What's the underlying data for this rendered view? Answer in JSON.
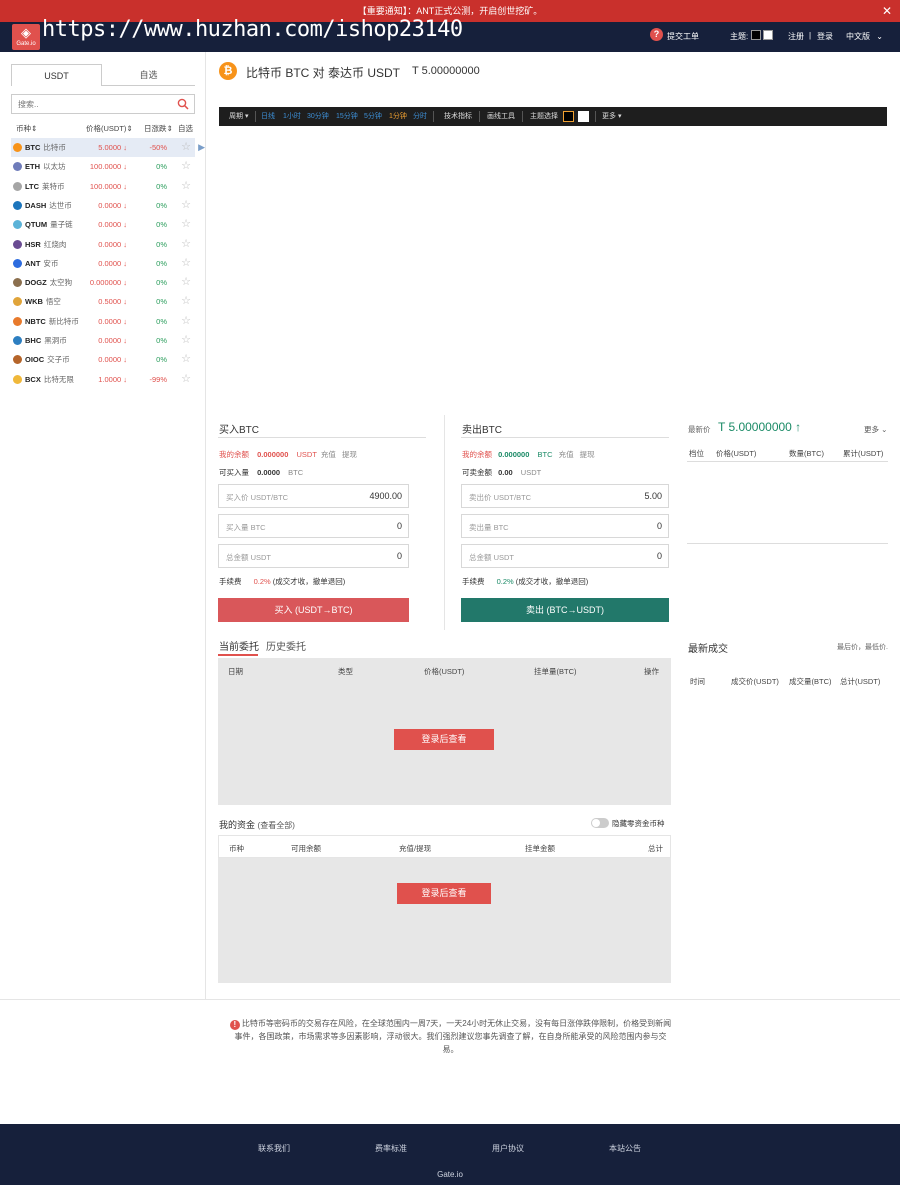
{
  "notice": {
    "text": "【重要通知】：ANT正式公测，开启创世挖矿。",
    "close": "✕"
  },
  "header": {
    "logo_text": "Gate.io",
    "watermark": "https://www.huzhan.com/ishop23140",
    "submit_ticket": "提交工单",
    "theme_label": "主题:",
    "register": "注册",
    "divider": "|",
    "login": "登录",
    "language": "中文版"
  },
  "market": {
    "tabs": [
      "USDT",
      "自选"
    ],
    "search_placeholder": "搜索..",
    "columns": [
      "币种⇕",
      "价格(USDT)⇕",
      "日涨跌⇕",
      "自选"
    ],
    "rows": [
      {
        "symbol": "BTC",
        "name": "比特币",
        "price": "5.0000 ↓",
        "change": "-50%",
        "neg": true,
        "color": "#f7931a"
      },
      {
        "symbol": "ETH",
        "name": "以太坊",
        "price": "100.0000 ↓",
        "change": "0%",
        "neg": false,
        "color": "#6f7cba"
      },
      {
        "symbol": "LTC",
        "name": "莱特币",
        "price": "100.0000 ↓",
        "change": "0%",
        "neg": false,
        "color": "#a5a5a5"
      },
      {
        "symbol": "DASH",
        "name": "达世币",
        "price": "0.0000 ↓",
        "change": "0%",
        "neg": false,
        "color": "#1c75bc"
      },
      {
        "symbol": "QTUM",
        "name": "量子链",
        "price": "0.0000 ↓",
        "change": "0%",
        "neg": false,
        "color": "#5cb3d8"
      },
      {
        "symbol": "HSR",
        "name": "红烧肉",
        "price": "0.0000 ↓",
        "change": "0%",
        "neg": false,
        "color": "#6a4c93"
      },
      {
        "symbol": "ANT",
        "name": "安币",
        "price": "0.0000 ↓",
        "change": "0%",
        "neg": false,
        "color": "#2d6cdf"
      },
      {
        "symbol": "DOGZ",
        "name": "太空狗",
        "price": "0.000000 ↓",
        "change": "0%",
        "neg": false,
        "color": "#8b6f4e"
      },
      {
        "symbol": "WKB",
        "name": "悟空",
        "price": "0.5000 ↓",
        "change": "0%",
        "neg": false,
        "color": "#e0a43a"
      },
      {
        "symbol": "NBTC",
        "name": "新比特币",
        "price": "0.0000 ↓",
        "change": "0%",
        "neg": false,
        "color": "#e87a2c"
      },
      {
        "symbol": "BHC",
        "name": "黑洞币",
        "price": "0.0000 ↓",
        "change": "0%",
        "neg": false,
        "color": "#2d7fc1"
      },
      {
        "symbol": "OIOC",
        "name": "交子币",
        "price": "0.0000 ↓",
        "change": "0%",
        "neg": false,
        "color": "#b5652a"
      },
      {
        "symbol": "BCX",
        "name": "比特无限",
        "price": "1.0000 ↓",
        "change": "-99%",
        "neg": true,
        "color": "#f0b83a"
      }
    ]
  },
  "pair": {
    "title": "比特币 BTC 对 泰达币 USDT",
    "price": "T 5.00000000"
  },
  "chart_toolbar": {
    "period": "周期 ▾",
    "intervals": [
      "日线",
      "1小时",
      "30分钟",
      "15分钟",
      "5分钟",
      "1分钟",
      "分时"
    ],
    "tech": "技术指标",
    "draw": "画线工具",
    "theme": "主题选择",
    "more": "更多 ▾"
  },
  "buy": {
    "title": "买入BTC",
    "balance_label": "我的余额",
    "balance": "0.000000",
    "unit": "USDT",
    "recharge": "充值",
    "withdraw": "提现",
    "avail_label": "可买入量",
    "avail": "0.0000",
    "avail_unit": "BTC",
    "price_ph": "买入价 USDT/BTC",
    "price_val": "4900.00",
    "amount_ph": "买入量 BTC",
    "amount_val": "0",
    "total_ph": "总金额 USDT",
    "total_val": "0",
    "fee_label": "手续费",
    "fee": "0.2%",
    "fee_note": "(成交才收，撤单退回)",
    "button": "买入 (USDT→BTC)"
  },
  "sell": {
    "title": "卖出BTC",
    "balance_label": "我的余额",
    "balance": "0.000000",
    "unit": "BTC",
    "recharge": "充值",
    "withdraw": "提现",
    "avail_label": "可卖金额",
    "avail": "0.00",
    "avail_unit": "USDT",
    "price_ph": "卖出价 USDT/BTC",
    "price_val": "5.00",
    "amount_ph": "卖出量 BTC",
    "amount_val": "0",
    "total_ph": "总金额 USDT",
    "total_val": "0",
    "fee_label": "手续费",
    "fee": "0.2%",
    "fee_note": "(成交才收，撤单退回)",
    "button": "卖出 (BTC→USDT)"
  },
  "orderbook": {
    "last_label": "最新价",
    "last_price": "T 5.00000000 ↑",
    "more": "更多 ⌄",
    "columns": [
      "档位",
      "价格(USDT)",
      "数量(BTC)",
      "累计(USDT)"
    ]
  },
  "orders": {
    "tab_current": "当前委托",
    "tab_history": "历史委托",
    "columns": [
      "日期",
      "类型",
      "价格(USDT)",
      "挂单量(BTC)",
      "操作"
    ],
    "login": "登录后查看"
  },
  "trades": {
    "title": "最新成交",
    "sub": "最后价，最低价.",
    "columns": [
      "时间",
      "成交价(USDT)",
      "成交量(BTC)",
      "总计(USDT)"
    ]
  },
  "funds": {
    "title": "我的资金",
    "view_all": "(查看全部)",
    "hide_zero": "隐藏零资金币种",
    "columns": [
      "币种",
      "可用余额",
      "充值/提现",
      "挂单金额",
      "总计"
    ],
    "login": "登录后查看"
  },
  "risk": {
    "icon": "!",
    "text": "比特币等密码币的交易存在风险，在全球范围内一周7天，一天24小时无休止交易，没有每日涨停跌停限制，价格受到新闻事件，各国政策，市场需求等多因素影响，浮动很大。我们强烈建议您事先调查了解，在自身所能承受的风险范围内参与交易。"
  },
  "footer": {
    "links": [
      "联系我们",
      "费率标准",
      "用户协议",
      "本站公告"
    ],
    "brand": "Gate.io"
  }
}
